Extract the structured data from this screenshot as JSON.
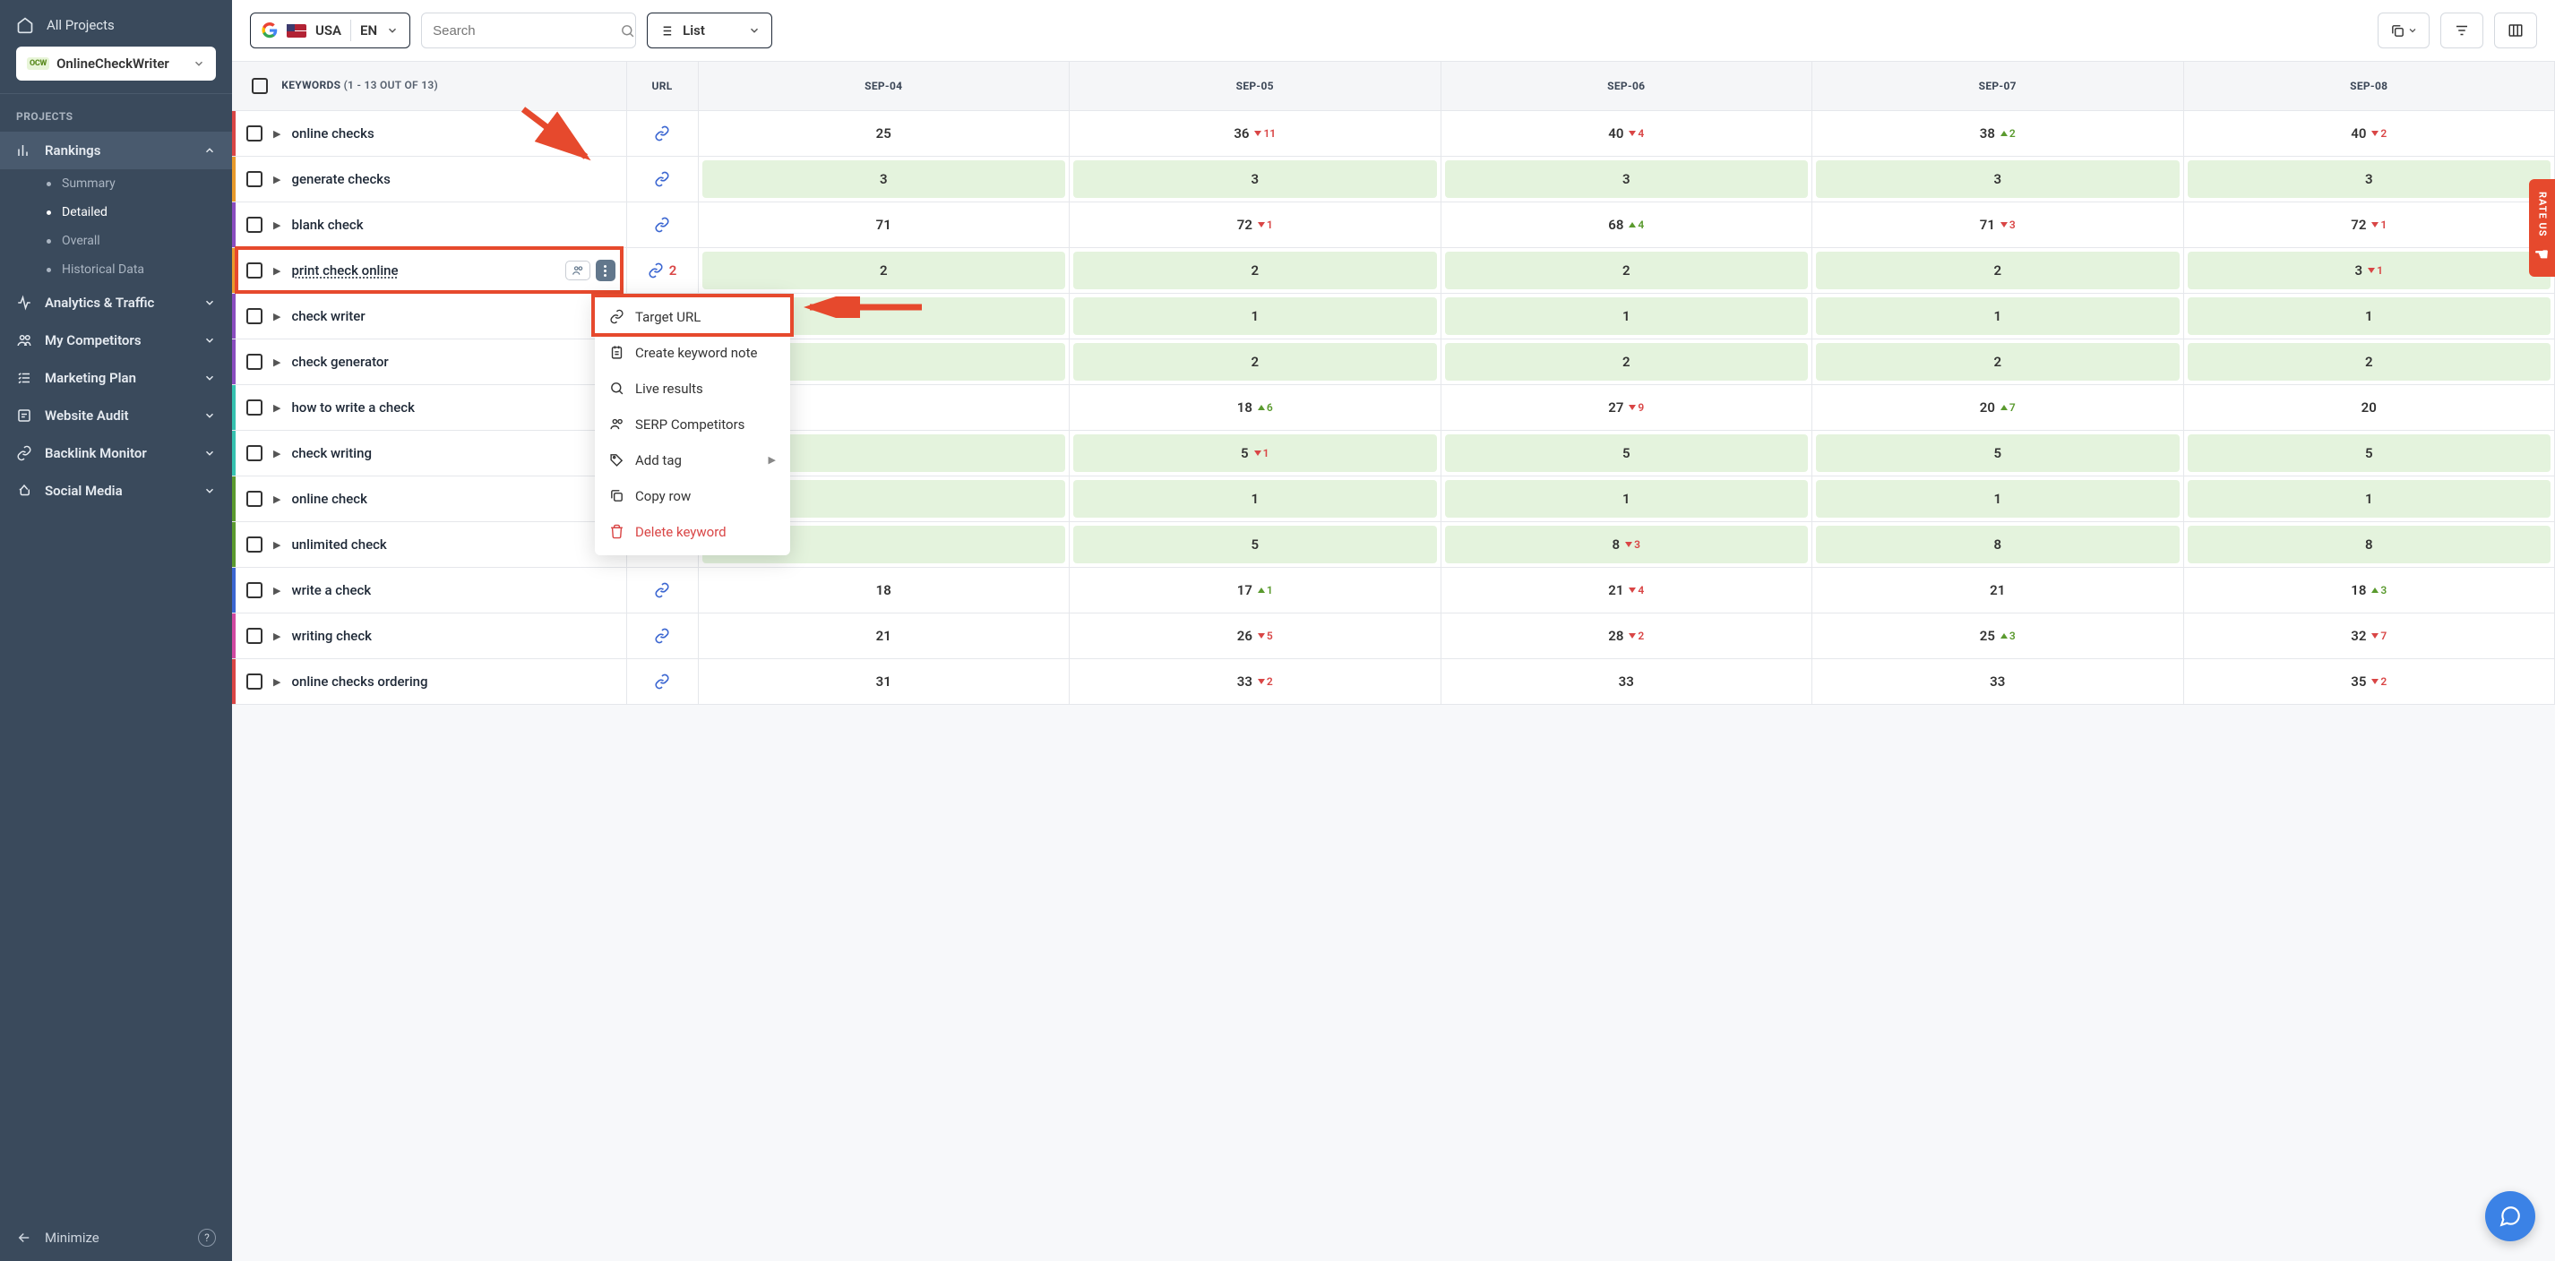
{
  "sidebar": {
    "all_projects": "All Projects",
    "project_name": "OnlineCheckWriter",
    "project_logo": "OCW",
    "section_label": "PROJECTS",
    "nav": {
      "rankings": "Rankings",
      "rankings_sub": [
        "Summary",
        "Detailed",
        "Overall",
        "Historical Data"
      ],
      "analytics": "Analytics & Traffic",
      "competitors": "My Competitors",
      "marketing": "Marketing Plan",
      "audit": "Website Audit",
      "backlink": "Backlink Monitor",
      "social": "Social Media"
    },
    "minimize": "Minimize"
  },
  "toolbar": {
    "country": "USA",
    "lang": "EN",
    "search_placeholder": "Search",
    "view_mode": "List"
  },
  "table": {
    "header_keywords": "KEYWORDS",
    "header_keywords_sub": "(1 - 13 OUT OF 13)",
    "header_url": "URL",
    "date_cols": [
      "SEP-04",
      "SEP-05",
      "SEP-06",
      "SEP-07",
      "SEP-08"
    ],
    "rows": [
      {
        "bar": "#d94545",
        "kw": "online checks",
        "cells": [
          {
            "v": 25
          },
          {
            "v": 36,
            "d": -11
          },
          {
            "v": 40,
            "d": -4
          },
          {
            "v": 38,
            "d": 2
          },
          {
            "v": 40,
            "d": -2
          }
        ]
      },
      {
        "bar": "#e89a2b",
        "kw": "generate checks",
        "cells": [
          {
            "v": 3,
            "g": 1
          },
          {
            "v": 3,
            "g": 1
          },
          {
            "v": 3,
            "g": 1
          },
          {
            "v": 3,
            "g": 1
          },
          {
            "v": 3,
            "g": 1
          }
        ]
      },
      {
        "bar": "#8a4dbf",
        "kw": "blank check",
        "cells": [
          {
            "v": 71
          },
          {
            "v": 72,
            "d": -1
          },
          {
            "v": 68,
            "d": 4
          },
          {
            "v": 71,
            "d": -3
          },
          {
            "v": 72,
            "d": -1
          }
        ]
      },
      {
        "bar": "#e89a2b",
        "kw": "print check online",
        "hl": 1,
        "url_cnt": 2,
        "cells": [
          {
            "v": 2,
            "g": 1
          },
          {
            "v": 2,
            "g": 1
          },
          {
            "v": 2,
            "g": 1
          },
          {
            "v": 2,
            "g": 1
          },
          {
            "v": 3,
            "d": -1,
            "g": 1
          }
        ]
      },
      {
        "bar": "#8a4dbf",
        "kw": "check writer",
        "cells": [
          {
            "v": null,
            "g": 1
          },
          {
            "v": 1,
            "g": 1
          },
          {
            "v": 1,
            "g": 1
          },
          {
            "v": 1,
            "g": 1
          },
          {
            "v": 1,
            "g": 1
          }
        ]
      },
      {
        "bar": "#8a4dbf",
        "kw": "check generator",
        "cells": [
          {
            "v": null,
            "g": 1
          },
          {
            "v": 2,
            "g": 1
          },
          {
            "v": 2,
            "g": 1
          },
          {
            "v": 2,
            "g": 1
          },
          {
            "v": 2,
            "g": 1
          }
        ]
      },
      {
        "bar": "#35c2b0",
        "kw": "how to write a check",
        "cells": [
          {
            "v": null
          },
          {
            "v": 18,
            "d": 6
          },
          {
            "v": 27,
            "d": -9
          },
          {
            "v": 20,
            "d": 7
          },
          {
            "v": 20
          }
        ]
      },
      {
        "bar": "#35c2b0",
        "kw": "check writing",
        "cells": [
          {
            "v": null,
            "g": 1
          },
          {
            "v": 5,
            "d": -1,
            "g": 1
          },
          {
            "v": 5,
            "g": 1
          },
          {
            "v": 5,
            "g": 1
          },
          {
            "v": 5,
            "g": 1
          }
        ]
      },
      {
        "bar": "#5a9a2e",
        "kw": "online check",
        "cells": [
          {
            "v": null,
            "g": 1
          },
          {
            "v": 1,
            "g": 1
          },
          {
            "v": 1,
            "g": 1
          },
          {
            "v": 1,
            "g": 1
          },
          {
            "v": 1,
            "g": 1
          }
        ]
      },
      {
        "bar": "#5a9a2e",
        "kw": "unlimited check",
        "cells": [
          {
            "v": null,
            "g": 1
          },
          {
            "v": 5,
            "g": 1
          },
          {
            "v": 8,
            "d": -3,
            "g": 1
          },
          {
            "v": 8,
            "g": 1
          },
          {
            "v": 8,
            "g": 1
          }
        ]
      },
      {
        "bar": "#3b66d1",
        "kw": "write a check",
        "cells": [
          {
            "v": 18
          },
          {
            "v": 17,
            "d": 1
          },
          {
            "v": 21,
            "d": -4
          },
          {
            "v": 21
          },
          {
            "v": 18,
            "d": 3
          }
        ]
      },
      {
        "bar": "#d149a1",
        "kw": "writing check",
        "cells": [
          {
            "v": 21
          },
          {
            "v": 26,
            "d": -5
          },
          {
            "v": 28,
            "d": -2
          },
          {
            "v": 25,
            "d": 3
          },
          {
            "v": 32,
            "d": -7
          }
        ]
      },
      {
        "bar": "#d94545",
        "kw": "online checks ordering",
        "cells": [
          {
            "v": 31
          },
          {
            "v": 33,
            "d": -2
          },
          {
            "v": 33
          },
          {
            "v": 33
          },
          {
            "v": 35,
            "d": -2
          }
        ]
      }
    ]
  },
  "context_menu": {
    "items": [
      {
        "icon": "link",
        "label": "Target URL",
        "hl": 1
      },
      {
        "icon": "note",
        "label": "Create keyword note"
      },
      {
        "icon": "search",
        "label": "Live results"
      },
      {
        "icon": "people",
        "label": "SERP Competitors"
      },
      {
        "icon": "tag",
        "label": "Add tag",
        "chev": 1
      },
      {
        "icon": "copy",
        "label": "Copy row"
      },
      {
        "icon": "trash",
        "label": "Delete keyword",
        "danger": 1
      }
    ]
  },
  "rate_us": "RATE US",
  "colors": {
    "highlight": "#e6492d",
    "green_cell": "#e4f3dd",
    "sidebar": "#3a4a5c",
    "link": "#3b66d1"
  }
}
